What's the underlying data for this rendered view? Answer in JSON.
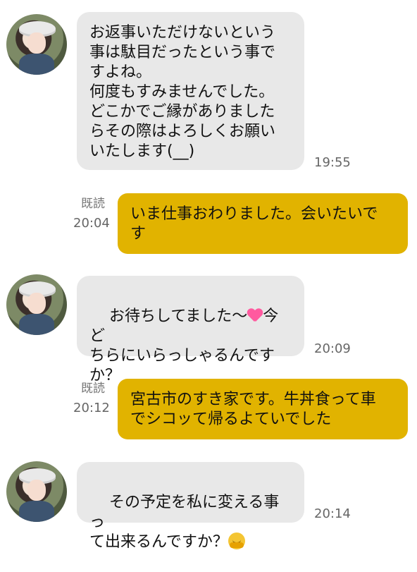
{
  "messages": [
    {
      "direction": "incoming",
      "text": "お返事いただけないという\n事は駄目だったという事で\nすよね。\n何度もすみませんでした。\nどこかでご縁がありました\nらその際はよろしくお願い\nいたします(__)",
      "time": "19:55"
    },
    {
      "direction": "outgoing",
      "read_label": "既読",
      "text": "いま仕事おわりました。会いたいで\nす",
      "time": "20:04"
    },
    {
      "direction": "incoming",
      "text_before_emoji": "お待ちしてました〜",
      "emoji": "heart",
      "text_after_emoji": "今ど\nちらにいらっしゃるんです\nか？",
      "time": "20:09"
    },
    {
      "direction": "outgoing",
      "read_label": "既読",
      "text": "宮古市のすき家です。牛丼食って車\nでシコッて帰るよていでした",
      "time": "20:12"
    },
    {
      "direction": "incoming",
      "text_before_emoji": "その予定を私に変える事っ\nて出来るんですか？",
      "emoji": "hugging-face",
      "time": "20:14"
    }
  ]
}
